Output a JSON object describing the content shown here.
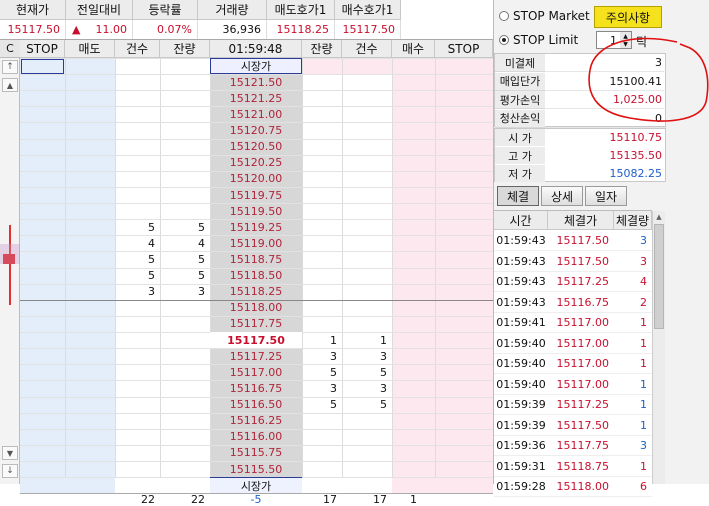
{
  "summary": {
    "headers": [
      "현재가",
      "전일대비",
      "등락률",
      "거래량",
      "매도호가1",
      "매수호가1"
    ],
    "values": [
      "15117.50",
      "11.00",
      "0.07%",
      "36,936",
      "15118.25",
      "15117.50"
    ],
    "change_arrow": "▲"
  },
  "order": {
    "col_c": "C",
    "headers": [
      "STOP",
      "매도",
      "건수",
      "잔량",
      "01:59:48",
      "잔량",
      "건수",
      "매수",
      "STOP"
    ],
    "market_top": "시장가",
    "market_bottom": "시장가",
    "rows": [
      {
        "price": "15121.50",
        "sc": "",
        "sq": "",
        "bq": "",
        "bc": ""
      },
      {
        "price": "15121.25",
        "sc": "",
        "sq": "",
        "bq": "",
        "bc": ""
      },
      {
        "price": "15121.00",
        "sc": "",
        "sq": "",
        "bq": "",
        "bc": ""
      },
      {
        "price": "15120.75",
        "sc": "",
        "sq": "",
        "bq": "",
        "bc": ""
      },
      {
        "price": "15120.50",
        "sc": "",
        "sq": "",
        "bq": "",
        "bc": ""
      },
      {
        "price": "15120.25",
        "sc": "",
        "sq": "",
        "bq": "",
        "bc": ""
      },
      {
        "price": "15120.00",
        "sc": "",
        "sq": "",
        "bq": "",
        "bc": ""
      },
      {
        "price": "15119.75",
        "sc": "",
        "sq": "",
        "bq": "",
        "bc": ""
      },
      {
        "price": "15119.50",
        "sc": "",
        "sq": "",
        "bq": "",
        "bc": ""
      },
      {
        "price": "15119.25",
        "sc": "5",
        "sq": "5",
        "bq": "",
        "bc": ""
      },
      {
        "price": "15119.00",
        "sc": "4",
        "sq": "4",
        "bq": "",
        "bc": ""
      },
      {
        "price": "15118.75",
        "sc": "5",
        "sq": "5",
        "bq": "",
        "bc": ""
      },
      {
        "price": "15118.50",
        "sc": "5",
        "sq": "5",
        "bq": "",
        "bc": ""
      },
      {
        "price": "15118.25",
        "sc": "3",
        "sq": "3",
        "bq": "",
        "bc": ""
      },
      {
        "price": "15118.00",
        "sc": "",
        "sq": "",
        "bq": "",
        "bc": ""
      },
      {
        "price": "15117.75",
        "sc": "",
        "sq": "",
        "bq": "",
        "bc": ""
      },
      {
        "price": "15117.50",
        "sc": "",
        "sq": "",
        "bq": "1",
        "bc": "1"
      },
      {
        "price": "15117.25",
        "sc": "",
        "sq": "",
        "bq": "3",
        "bc": "3"
      },
      {
        "price": "15117.00",
        "sc": "",
        "sq": "",
        "bq": "5",
        "bc": "5"
      },
      {
        "price": "15116.75",
        "sc": "",
        "sq": "",
        "bq": "3",
        "bc": "3"
      },
      {
        "price": "15116.50",
        "sc": "",
        "sq": "",
        "bq": "5",
        "bc": "5"
      },
      {
        "price": "15116.25",
        "sc": "",
        "sq": "",
        "bq": "",
        "bc": ""
      },
      {
        "price": "15116.00",
        "sc": "",
        "sq": "",
        "bq": "",
        "bc": ""
      },
      {
        "price": "15115.75",
        "sc": "",
        "sq": "",
        "bq": "",
        "bc": ""
      },
      {
        "price": "15115.50",
        "sc": "",
        "sq": "",
        "bq": "",
        "bc": ""
      }
    ],
    "totals": {
      "sc": "22",
      "sq": "22",
      "diff": "-5",
      "bq": "17",
      "bc": "17",
      "buy": "1"
    }
  },
  "right": {
    "stop_market": "STOP Market",
    "stop_limit": "STOP Limit",
    "caution_button": "주의사항",
    "tick_value": "1",
    "tick_label": "틱",
    "info": [
      {
        "label": "미결제",
        "value": "3"
      },
      {
        "label": "매입단가",
        "value": "15100.41"
      },
      {
        "label": "평가손익",
        "value": "1,025.00"
      },
      {
        "label": "청산손익",
        "value": "0"
      }
    ],
    "ohl": [
      {
        "label": "시 가",
        "value": "15110.75"
      },
      {
        "label": "고 가",
        "value": "15135.50"
      },
      {
        "label": "저 가",
        "value": "15082.25"
      }
    ],
    "tabs": [
      "체결",
      "상세",
      "일자"
    ],
    "trade_headers": [
      "시간",
      "체결가",
      "체결량"
    ],
    "trades": [
      {
        "t": "01:59:43",
        "p": "15117.50",
        "q": "3"
      },
      {
        "t": "01:59:43",
        "p": "15117.50",
        "q": "3"
      },
      {
        "t": "01:59:43",
        "p": "15117.25",
        "q": "4"
      },
      {
        "t": "01:59:43",
        "p": "15116.75",
        "q": "2"
      },
      {
        "t": "01:59:41",
        "p": "15117.00",
        "q": "1"
      },
      {
        "t": "01:59:40",
        "p": "15117.00",
        "q": "1"
      },
      {
        "t": "01:59:40",
        "p": "15117.00",
        "q": "1"
      },
      {
        "t": "01:59:40",
        "p": "15117.00",
        "q": "1"
      },
      {
        "t": "01:59:39",
        "p": "15117.25",
        "q": "1"
      },
      {
        "t": "01:59:39",
        "p": "15117.50",
        "q": "1"
      },
      {
        "t": "01:59:36",
        "p": "15117.75",
        "q": "3"
      },
      {
        "t": "01:59:31",
        "p": "15118.75",
        "q": "1"
      },
      {
        "t": "01:59:28",
        "p": "15118.00",
        "q": "6"
      }
    ]
  },
  "colors": {
    "sell_bg": "#e4eefa",
    "buy_bg": "#fce8ee",
    "price_bg": "#d7d7d7",
    "red": "#c8102e",
    "blue": "#1e5fc8",
    "annotation": "#e01010"
  }
}
